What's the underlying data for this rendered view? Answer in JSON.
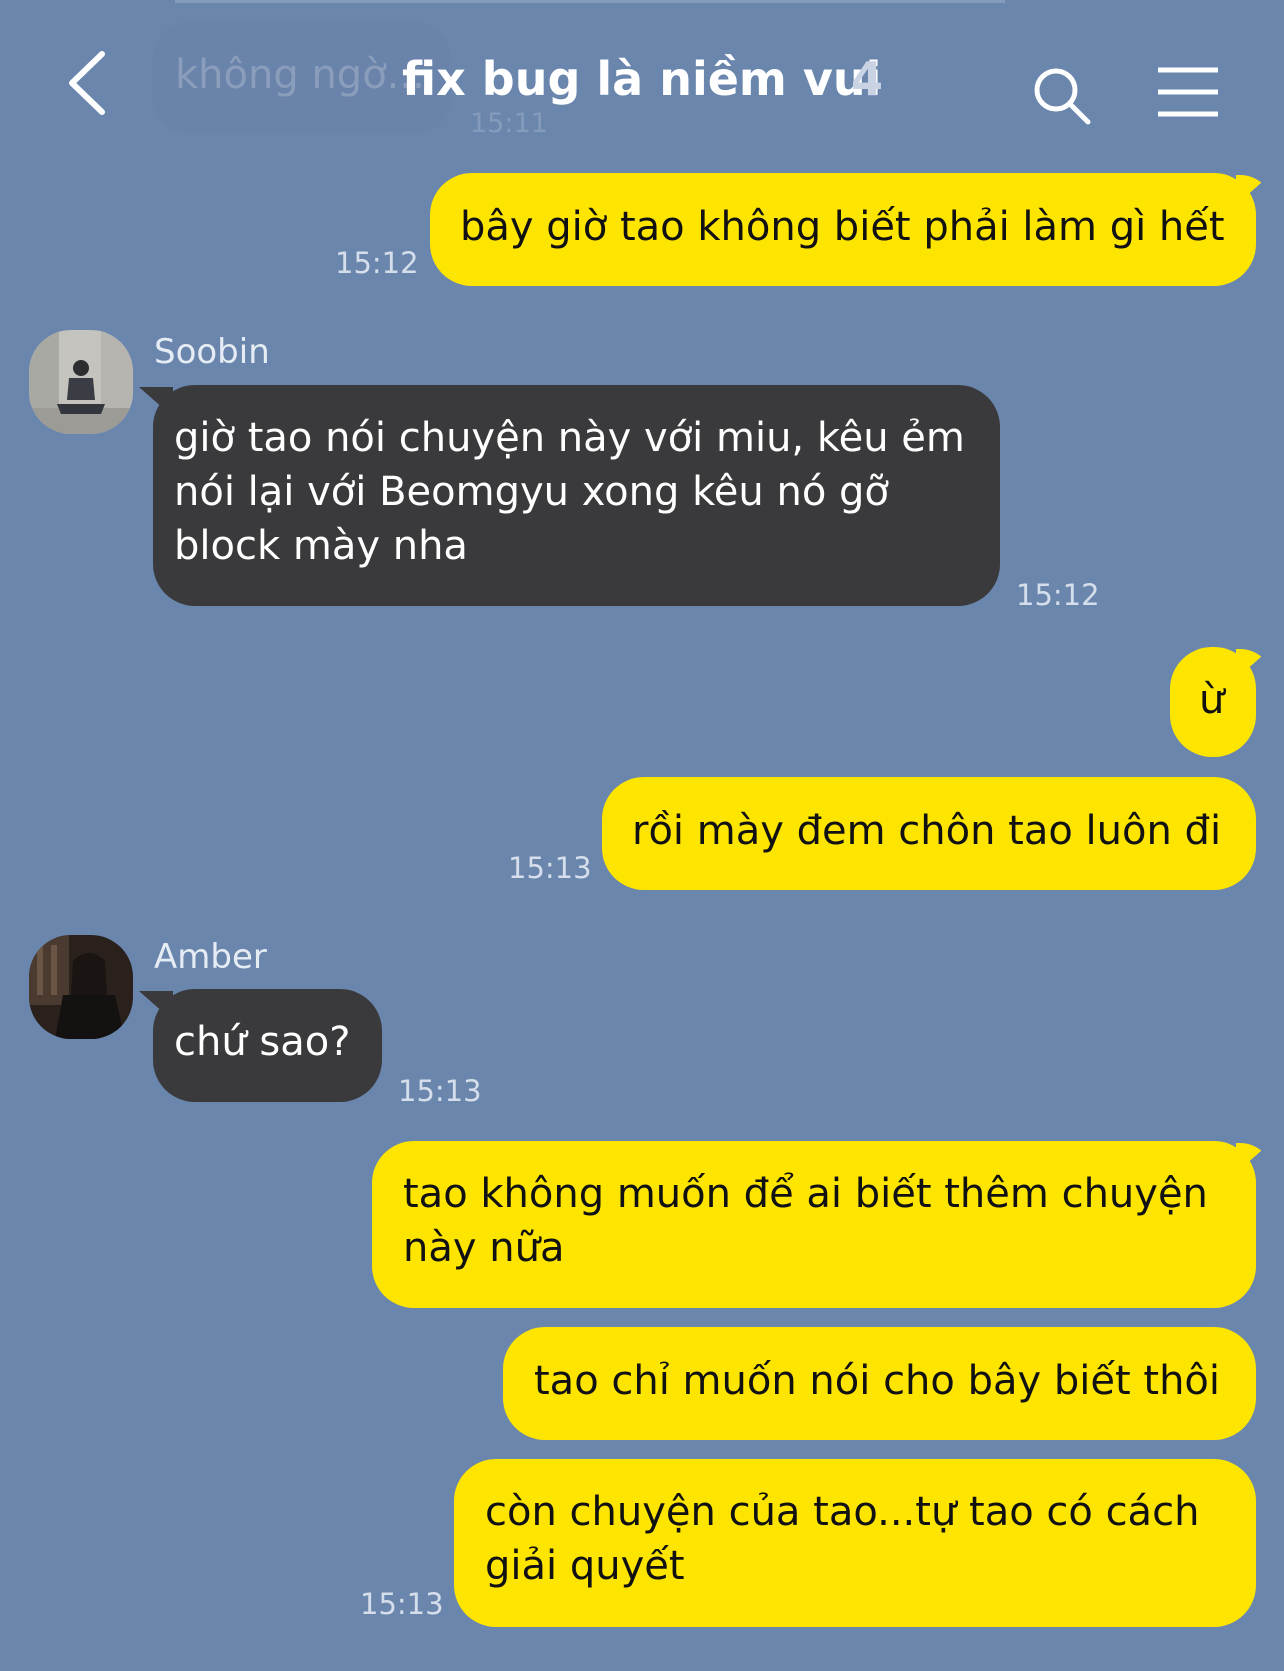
{
  "header": {
    "title": "fix bug là niềm vui",
    "member_count": "4",
    "ghost_prev_message": "không ngờ...",
    "ghost_prev_time": "15:11"
  },
  "messages": {
    "m1": {
      "text": "bây giờ tao không biết phải làm gì hết",
      "time": "15:12"
    },
    "soobin": {
      "name": "Soobin"
    },
    "m2": {
      "line1": "giờ tao nói chuyện này với miu, kêu ẻm",
      "line2": "nói lại với Beomgyu xong kêu nó gỡ",
      "line3": "block mày nha",
      "time": "15:12"
    },
    "m3": {
      "text": "ừ"
    },
    "m4": {
      "text": "rồi mày đem chôn tao luôn đi",
      "time": "15:13"
    },
    "amber": {
      "name": "Amber"
    },
    "m5": {
      "text": "chứ sao?",
      "time": "15:13"
    },
    "m6": {
      "line1": "tao không muốn để ai biết thêm chuyện",
      "line2": "này nữa"
    },
    "m7": {
      "text": "tao chỉ muốn nói cho bây biết thôi"
    },
    "m8": {
      "line1": "còn chuyện của tao...tự tao có cách",
      "line2": "giải quyết",
      "time": "15:13"
    }
  },
  "icons": {
    "back": "chevron-left-icon",
    "search": "search-icon",
    "menu": "hamburger-menu-icon"
  },
  "colors": {
    "background": "#6a86ad",
    "my_bubble": "#fee500",
    "their_bubble": "#3a3a3c",
    "timestamp": "#d5deea"
  }
}
